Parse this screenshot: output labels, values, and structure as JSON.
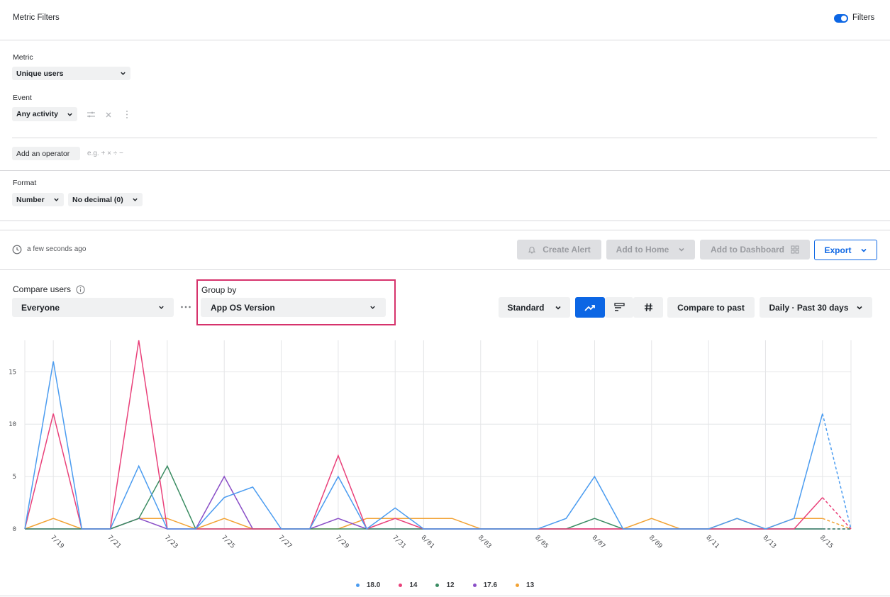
{
  "header": {
    "title": "Metric Filters",
    "filters_toggle_label": "Filters"
  },
  "metric": {
    "label": "Metric",
    "value": "Unique users"
  },
  "event": {
    "label": "Event",
    "value": "Any activity"
  },
  "operator": {
    "button_label": "Add an operator",
    "hint": "e.g. + × ÷ −"
  },
  "format": {
    "label": "Format",
    "number": "Number",
    "decimal": "No decimal (0)"
  },
  "toolbar": {
    "updated": "a few seconds ago",
    "create_alert": "Create Alert",
    "add_to_home": "Add to Home",
    "add_to_dashboard": "Add to Dashboard",
    "export": "Export"
  },
  "controls": {
    "compare_users_label": "Compare users",
    "compare_users_value": "Everyone",
    "group_by_label": "Group by",
    "group_by_value": "App OS Version",
    "mode": "Standard",
    "compare_to_past": "Compare to past",
    "range": "Daily · Past 30 days"
  },
  "chart_data": {
    "type": "line",
    "x": [
      "7/18",
      "7/19",
      "7/20",
      "7/21",
      "7/22",
      "7/23",
      "7/24",
      "7/25",
      "7/26",
      "7/27",
      "7/28",
      "7/29",
      "7/30",
      "7/31",
      "8/01",
      "8/02",
      "8/03",
      "8/04",
      "8/05",
      "8/06",
      "8/07",
      "8/08",
      "8/09",
      "8/10",
      "8/11",
      "8/12",
      "8/13",
      "8/14",
      "8/15",
      "8/16"
    ],
    "x_tick_labels": [
      "7/19",
      "7/21",
      "7/23",
      "7/25",
      "7/27",
      "7/29",
      "7/31",
      "8/01",
      "8/03",
      "8/05",
      "8/07",
      "8/09",
      "8/11",
      "8/13",
      "8/15"
    ],
    "y_ticks": [
      0,
      5,
      10,
      15
    ],
    "ylim": [
      0,
      18
    ],
    "incomplete_from_index": 28,
    "series": [
      {
        "name": "18.0",
        "color": "#4b9cf0",
        "values": [
          0,
          16,
          0,
          0,
          6,
          0,
          0,
          3,
          4,
          0,
          0,
          5,
          0,
          2,
          0,
          0,
          0,
          0,
          0,
          1,
          5,
          0,
          0,
          0,
          0,
          1,
          0,
          1,
          11,
          0
        ]
      },
      {
        "name": "14",
        "color": "#e9417a",
        "values": [
          0,
          11,
          0,
          0,
          18,
          0,
          0,
          0,
          0,
          0,
          0,
          7,
          0,
          1,
          0,
          0,
          0,
          0,
          0,
          0,
          0,
          0,
          0,
          0,
          0,
          0,
          0,
          0,
          3,
          0
        ]
      },
      {
        "name": "12",
        "color": "#3a8c62",
        "values": [
          0,
          0,
          0,
          0,
          1,
          6,
          0,
          0,
          0,
          0,
          0,
          0,
          0,
          0,
          0,
          0,
          0,
          0,
          0,
          0,
          1,
          0,
          0,
          0,
          0,
          0,
          0,
          0,
          0,
          0
        ]
      },
      {
        "name": "17.6",
        "color": "#8a4fc7",
        "values": [
          0,
          0,
          0,
          0,
          1,
          0,
          0,
          5,
          0,
          0,
          0,
          1,
          0,
          0,
          0,
          0,
          0,
          0,
          0,
          0,
          0,
          0,
          0,
          0,
          0,
          0,
          0,
          0,
          0,
          0
        ]
      },
      {
        "name": "13",
        "color": "#f2a233",
        "values": [
          0,
          1,
          0,
          0,
          1,
          1,
          0,
          1,
          0,
          0,
          0,
          0,
          1,
          1,
          1,
          1,
          0,
          0,
          0,
          0,
          0,
          0,
          1,
          0,
          0,
          1,
          0,
          1,
          1,
          0
        ]
      }
    ],
    "legend_position": "bottom-center",
    "grid": true
  }
}
